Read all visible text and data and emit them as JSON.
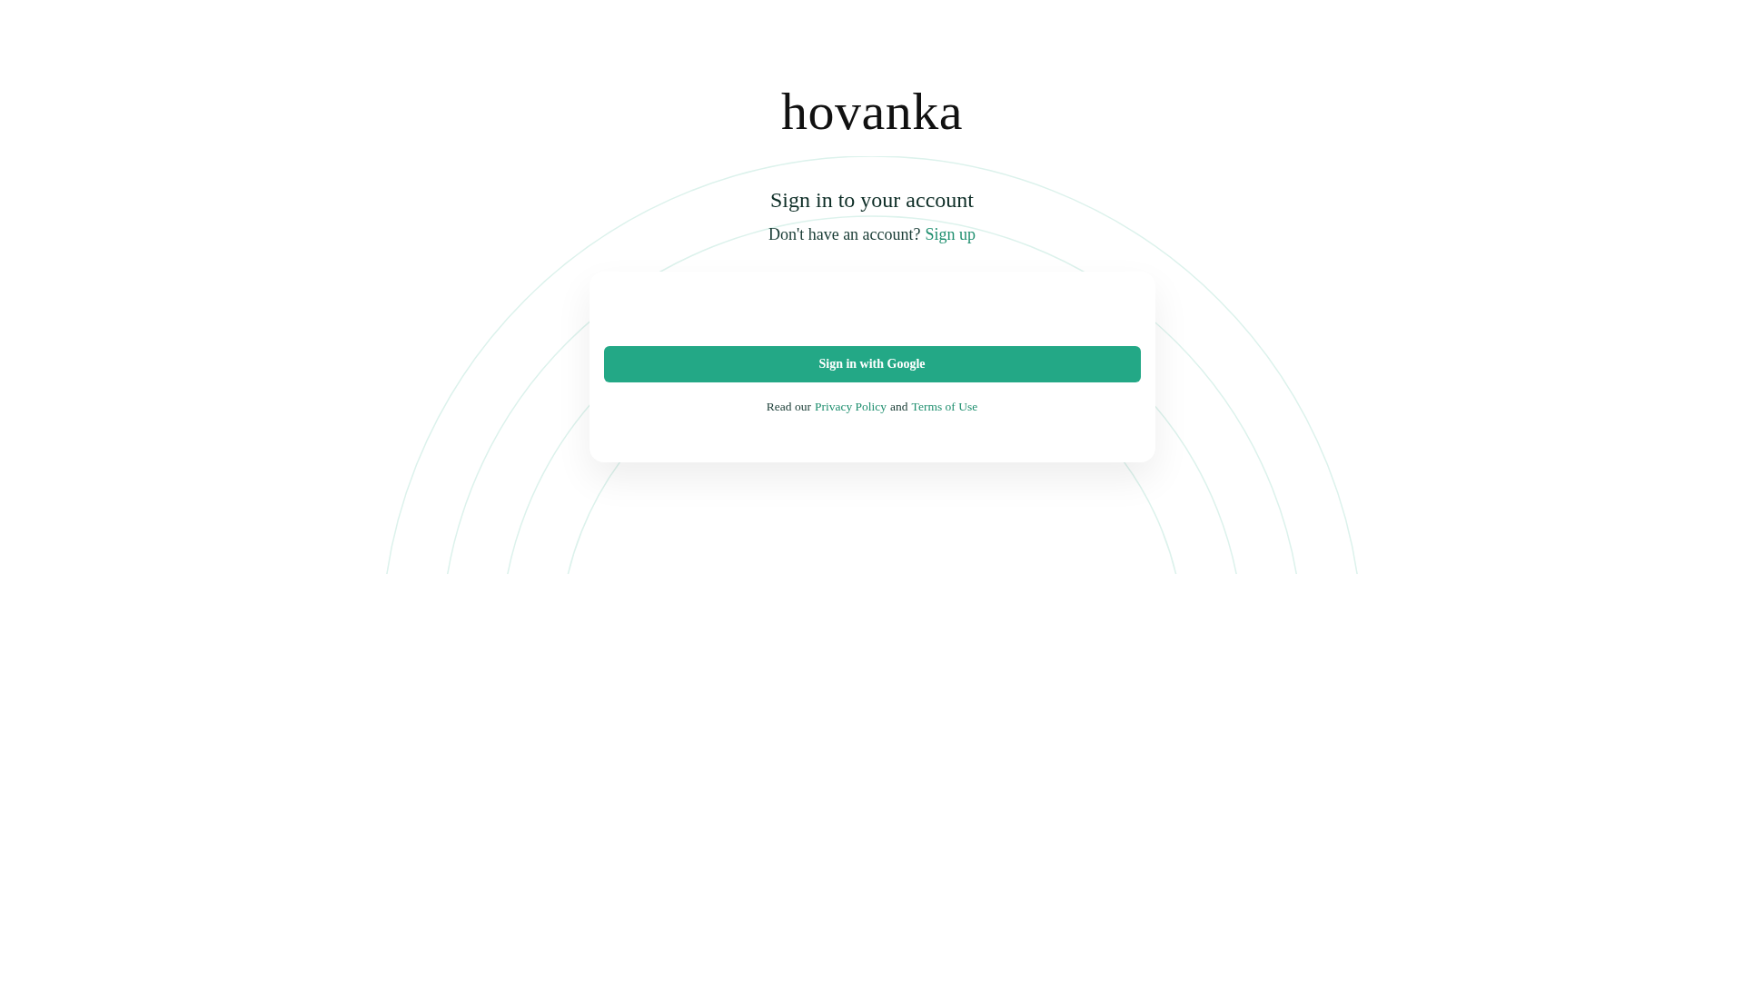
{
  "logo": "hovanka",
  "heading": "Sign in to your account",
  "signup_prompt": {
    "text": "Don't have an account?",
    "link": "Sign up"
  },
  "google_button": {
    "label": "Sign in with Google"
  },
  "legal": {
    "prefix": "Read our",
    "privacy_link": "Privacy Policy",
    "middle": "and",
    "terms_link": "Terms of Use"
  }
}
